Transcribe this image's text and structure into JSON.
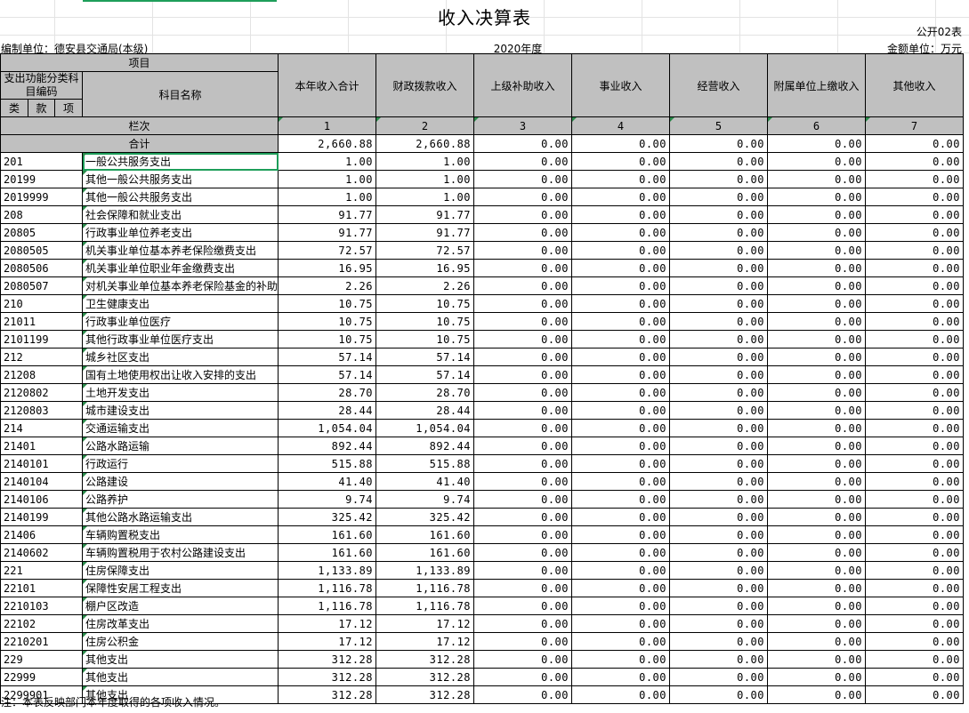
{
  "title": "收入决算表",
  "form_no": "公开02表",
  "unit": "编制单位：德安县交通局(本级)",
  "year": "2020年度",
  "amount_unit": "金额单位：万元",
  "header": {
    "item": "项目",
    "func_code": "支出功能分类科目编码",
    "subject_name": "科目名称",
    "lei": "类",
    "kuan": "款",
    "xiang": "项",
    "lanci": "栏次",
    "cols": [
      "本年收入合计",
      "财政拨款收入",
      "上级补助收入",
      "事业收入",
      "经营收入",
      "附属单位上缴收入",
      "其他收入"
    ],
    "col_nums": [
      "1",
      "2",
      "3",
      "4",
      "5",
      "6",
      "7"
    ]
  },
  "total": {
    "label": "合计",
    "values": [
      "2,660.88",
      "2,660.88",
      "0.00",
      "0.00",
      "0.00",
      "0.00",
      "0.00"
    ]
  },
  "rows": [
    {
      "code": "201",
      "name": "一般公共服务支出",
      "level": 0,
      "values": [
        "1.00",
        "1.00",
        "0.00",
        "0.00",
        "0.00",
        "0.00",
        "0.00"
      ]
    },
    {
      "code": "20199",
      "name": "其他一般公共服务支出",
      "level": 0,
      "values": [
        "1.00",
        "1.00",
        "0.00",
        "0.00",
        "0.00",
        "0.00",
        "0.00"
      ]
    },
    {
      "code": "2019999",
      "name": "其他一般公共服务支出",
      "level": 1,
      "values": [
        "1.00",
        "1.00",
        "0.00",
        "0.00",
        "0.00",
        "0.00",
        "0.00"
      ]
    },
    {
      "code": "208",
      "name": "社会保障和就业支出",
      "level": 0,
      "values": [
        "91.77",
        "91.77",
        "0.00",
        "0.00",
        "0.00",
        "0.00",
        "0.00"
      ]
    },
    {
      "code": "20805",
      "name": "行政事业单位养老支出",
      "level": 0,
      "values": [
        "91.77",
        "91.77",
        "0.00",
        "0.00",
        "0.00",
        "0.00",
        "0.00"
      ]
    },
    {
      "code": "2080505",
      "name": "机关事业单位基本养老保险缴费支出",
      "level": 1,
      "values": [
        "72.57",
        "72.57",
        "0.00",
        "0.00",
        "0.00",
        "0.00",
        "0.00"
      ]
    },
    {
      "code": "2080506",
      "name": "机关事业单位职业年金缴费支出",
      "level": 1,
      "values": [
        "16.95",
        "16.95",
        "0.00",
        "0.00",
        "0.00",
        "0.00",
        "0.00"
      ]
    },
    {
      "code": "2080507",
      "name": "对机关事业单位基本养老保险基金的补助",
      "level": 1,
      "small": true,
      "values": [
        "2.26",
        "2.26",
        "0.00",
        "0.00",
        "0.00",
        "0.00",
        "0.00"
      ]
    },
    {
      "code": "210",
      "name": "卫生健康支出",
      "level": 0,
      "values": [
        "10.75",
        "10.75",
        "0.00",
        "0.00",
        "0.00",
        "0.00",
        "0.00"
      ]
    },
    {
      "code": "21011",
      "name": "行政事业单位医疗",
      "level": 0,
      "values": [
        "10.75",
        "10.75",
        "0.00",
        "0.00",
        "0.00",
        "0.00",
        "0.00"
      ]
    },
    {
      "code": "2101199",
      "name": "其他行政事业单位医疗支出",
      "level": 1,
      "values": [
        "10.75",
        "10.75",
        "0.00",
        "0.00",
        "0.00",
        "0.00",
        "0.00"
      ]
    },
    {
      "code": "212",
      "name": "城乡社区支出",
      "level": 0,
      "values": [
        "57.14",
        "57.14",
        "0.00",
        "0.00",
        "0.00",
        "0.00",
        "0.00"
      ]
    },
    {
      "code": "21208",
      "name": "国有土地使用权出让收入安排的支出",
      "level": 0,
      "values": [
        "57.14",
        "57.14",
        "0.00",
        "0.00",
        "0.00",
        "0.00",
        "0.00"
      ]
    },
    {
      "code": "2120802",
      "name": "土地开发支出",
      "level": 1,
      "values": [
        "28.70",
        "28.70",
        "0.00",
        "0.00",
        "0.00",
        "0.00",
        "0.00"
      ]
    },
    {
      "code": "2120803",
      "name": "城市建设支出",
      "level": 1,
      "values": [
        "28.44",
        "28.44",
        "0.00",
        "0.00",
        "0.00",
        "0.00",
        "0.00"
      ]
    },
    {
      "code": "214",
      "name": "交通运输支出",
      "level": 0,
      "values": [
        "1,054.04",
        "1,054.04",
        "0.00",
        "0.00",
        "0.00",
        "0.00",
        "0.00"
      ]
    },
    {
      "code": "21401",
      "name": "公路水路运输",
      "level": 0,
      "values": [
        "892.44",
        "892.44",
        "0.00",
        "0.00",
        "0.00",
        "0.00",
        "0.00"
      ]
    },
    {
      "code": "2140101",
      "name": "行政运行",
      "level": 1,
      "values": [
        "515.88",
        "515.88",
        "0.00",
        "0.00",
        "0.00",
        "0.00",
        "0.00"
      ]
    },
    {
      "code": "2140104",
      "name": "公路建设",
      "level": 1,
      "values": [
        "41.40",
        "41.40",
        "0.00",
        "0.00",
        "0.00",
        "0.00",
        "0.00"
      ]
    },
    {
      "code": "2140106",
      "name": "公路养护",
      "level": 1,
      "values": [
        "9.74",
        "9.74",
        "0.00",
        "0.00",
        "0.00",
        "0.00",
        "0.00"
      ]
    },
    {
      "code": "2140199",
      "name": "其他公路水路运输支出",
      "level": 1,
      "values": [
        "325.42",
        "325.42",
        "0.00",
        "0.00",
        "0.00",
        "0.00",
        "0.00"
      ]
    },
    {
      "code": "21406",
      "name": "车辆购置税支出",
      "level": 0,
      "values": [
        "161.60",
        "161.60",
        "0.00",
        "0.00",
        "0.00",
        "0.00",
        "0.00"
      ]
    },
    {
      "code": "2140602",
      "name": "车辆购置税用于农村公路建设支出",
      "level": 1,
      "values": [
        "161.60",
        "161.60",
        "0.00",
        "0.00",
        "0.00",
        "0.00",
        "0.00"
      ]
    },
    {
      "code": "221",
      "name": "住房保障支出",
      "level": 0,
      "values": [
        "1,133.89",
        "1,133.89",
        "0.00",
        "0.00",
        "0.00",
        "0.00",
        "0.00"
      ]
    },
    {
      "code": "22101",
      "name": "保障性安居工程支出",
      "level": 0,
      "values": [
        "1,116.78",
        "1,116.78",
        "0.00",
        "0.00",
        "0.00",
        "0.00",
        "0.00"
      ]
    },
    {
      "code": "2210103",
      "name": "棚户区改造",
      "level": 1,
      "values": [
        "1,116.78",
        "1,116.78",
        "0.00",
        "0.00",
        "0.00",
        "0.00",
        "0.00"
      ]
    },
    {
      "code": "22102",
      "name": "住房改革支出",
      "level": 0,
      "values": [
        "17.12",
        "17.12",
        "0.00",
        "0.00",
        "0.00",
        "0.00",
        "0.00"
      ]
    },
    {
      "code": "2210201",
      "name": "住房公积金",
      "level": 1,
      "values": [
        "17.12",
        "17.12",
        "0.00",
        "0.00",
        "0.00",
        "0.00",
        "0.00"
      ]
    },
    {
      "code": "229",
      "name": "其他支出",
      "level": 0,
      "values": [
        "312.28",
        "312.28",
        "0.00",
        "0.00",
        "0.00",
        "0.00",
        "0.00"
      ]
    },
    {
      "code": "22999",
      "name": "其他支出",
      "level": 0,
      "values": [
        "312.28",
        "312.28",
        "0.00",
        "0.00",
        "0.00",
        "0.00",
        "0.00"
      ]
    },
    {
      "code": "2299901",
      "name": "其他支出",
      "level": 1,
      "values": [
        "312.28",
        "312.28",
        "0.00",
        "0.00",
        "0.00",
        "0.00",
        "0.00"
      ]
    }
  ],
  "note": "注：本表反映部门本年度取得的各项收入情况。",
  "colors": {
    "selection": "#1e9e5a",
    "header_bg": "#c0c0c0"
  }
}
